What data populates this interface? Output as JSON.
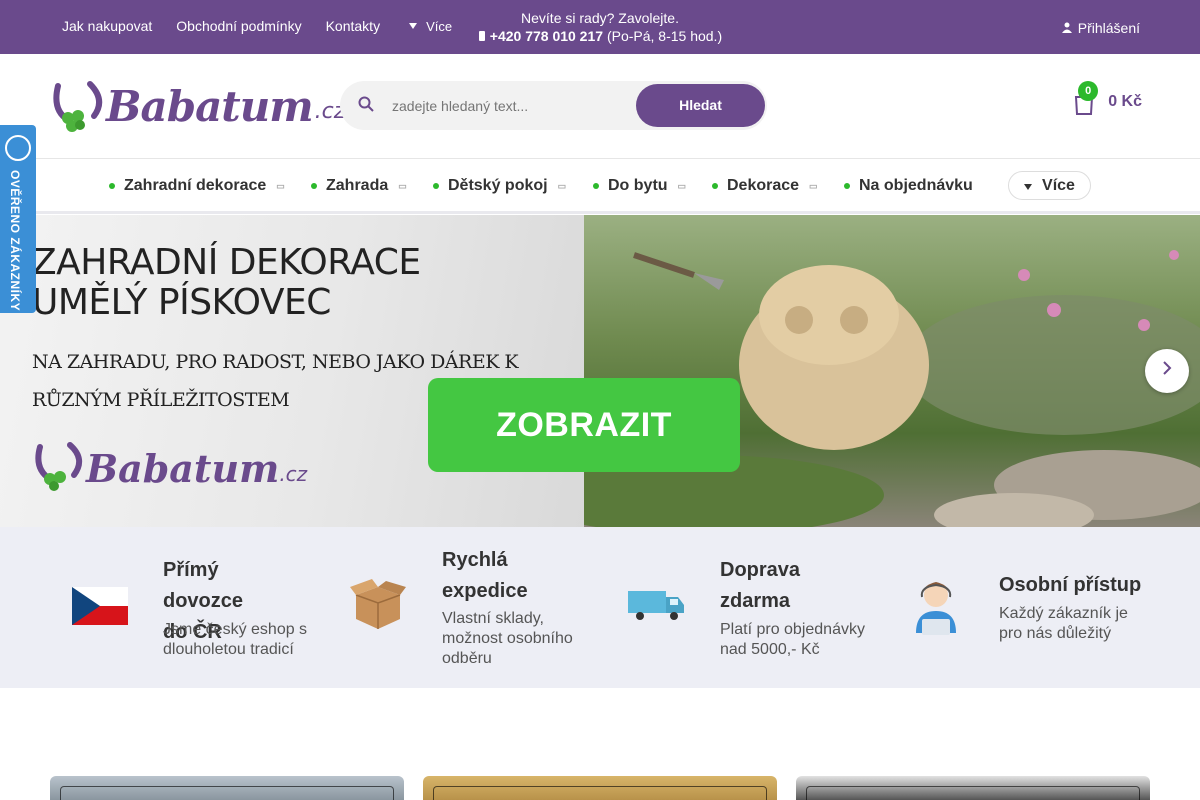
{
  "topbar": {
    "links": [
      "Jak nakupovat",
      "Obchodní podmínky",
      "Kontakty"
    ],
    "more_label": "Více",
    "help_line": "Nevíte si rady? Zavolejte.",
    "phone": "+420 778 010 217",
    "hours": "(Po-Pá, 8-15 hod.)",
    "login_label": "Přihlášení"
  },
  "header": {
    "logo_word": "Babatum",
    "logo_tld": ".cz",
    "search_placeholder": "zadejte hledaný text...",
    "search_button": "Hledat",
    "cart_count": "0",
    "cart_total": "0 Kč"
  },
  "nav": {
    "items": [
      "Zahradní dekorace",
      "Zahrada",
      "Dětský pokoj",
      "Do bytu",
      "Dekorace",
      "Na objednávku"
    ],
    "more_label": "Více"
  },
  "verified_badge": {
    "label": "OVĚŘENO ZÁKAZNÍKY"
  },
  "hero": {
    "title_line1": "ZAHRADNÍ DEKORACE",
    "title_line2": "UMĚLÝ PÍSKOVEC",
    "subtitle_line1": "NA ZAHRADU, PRO  RADOST, NEBO JAKO DÁREK K",
    "subtitle_line2": "RŮZNÝM PŘÍLEŽITOSTEM",
    "cta_label": "ZOBRAZIT",
    "logo_word": "Babatum",
    "logo_tld": ".cz"
  },
  "benefits": [
    {
      "icon": "czech-flag-icon",
      "title_line1": "Přímý dovozce",
      "title_line2": "do ČR",
      "desc_line1": "Jsme český eshop s",
      "desc_line2": "dlouholetou tradicí",
      "desc_line3": ""
    },
    {
      "icon": "box-icon",
      "title_line1": "Rychlá",
      "title_line2": "expedice",
      "desc_line1": "Vlastní sklady,",
      "desc_line2": "možnost osobního",
      "desc_line3": "odběru"
    },
    {
      "icon": "truck-icon",
      "title_line1": "Doprava",
      "title_line2": "zdarma",
      "desc_line1": "Platí pro objednávky",
      "desc_line2": "nad 5000,- Kč",
      "desc_line3": ""
    },
    {
      "icon": "support-person-icon",
      "title_line1": "Osobní přístup",
      "title_line2": "",
      "desc_line1": "Každý zákazník je",
      "desc_line2": "pro nás důležitý",
      "desc_line3": ""
    }
  ],
  "colors": {
    "brand_purple": "#6a4a8c",
    "accent_green": "#44c742",
    "badge_blue": "#3b8fd6",
    "benefits_bg": "#edeef5"
  }
}
